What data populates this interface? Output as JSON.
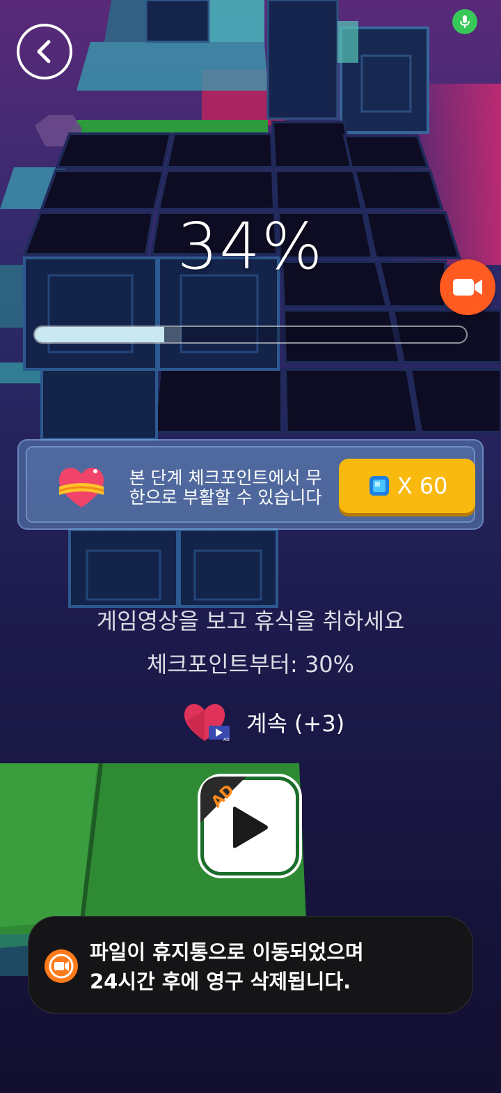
{
  "progress": {
    "percent_text": "34%",
    "value": 0.34,
    "checkpoint": 0.3
  },
  "revive_banner": {
    "line1": "본 단계 체크포인트에서 무",
    "line2": "한으로 부활할 수 있습니다",
    "gem_cost": "X 60"
  },
  "info": {
    "line1": "게임영상을 보고 휴식을 취하세요",
    "line2": "체크포인트부터: 30%"
  },
  "continue": {
    "label": "계속 (+3)",
    "badge": "AD"
  },
  "ad_button": {
    "badge": "AD"
  },
  "toast": {
    "line1": "파일이 휴지통으로 이동되었으며",
    "line2": "24시간 후에 영구 삭제됩니다."
  },
  "icons": [
    "back-icon",
    "microphone-icon",
    "video-camera-icon",
    "heart-badge-icon",
    "diamond-icon",
    "heart-ad-icon",
    "play-icon",
    "screen-recorder-icon"
  ],
  "colors": {
    "accent_orange": "#ff5a1f",
    "gem_button": "#f9b90f",
    "mic_green": "#38c85a",
    "progress_fill": "#c9e8f2"
  }
}
